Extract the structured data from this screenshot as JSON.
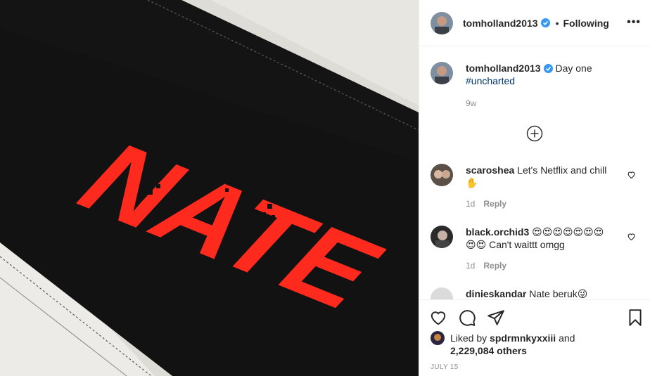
{
  "post": {
    "photo_text": "NATE",
    "author": "tomholland2013",
    "dot": "•",
    "following_label": "Following",
    "more_label": "•••",
    "caption_text": "Day one",
    "caption_tag": "#uncharted",
    "caption_age": "9w"
  },
  "comments": [
    {
      "user": "scaroshea",
      "text": "Let's Netflix and chill ✋",
      "age": "1d",
      "reply_label": "Reply"
    },
    {
      "user": "black.orchid3",
      "text": "😍😍😍😍😍😍😍😍😍 Can't waittt omgg",
      "age": "1d",
      "reply_label": "Reply"
    },
    {
      "user": "dinieskandar",
      "text": "Nate beruk😜",
      "age": "",
      "reply_label": ""
    }
  ],
  "likes": {
    "prefix": "Liked by",
    "liker": "spdrmnkyxxiii",
    "and": "and",
    "count": "2,229,084 others"
  },
  "post_date": "JULY 15",
  "colors": {
    "accent": "#ff2a1e",
    "link": "#00376b",
    "muted": "#8e8e8e",
    "verified": "#3897f0"
  }
}
